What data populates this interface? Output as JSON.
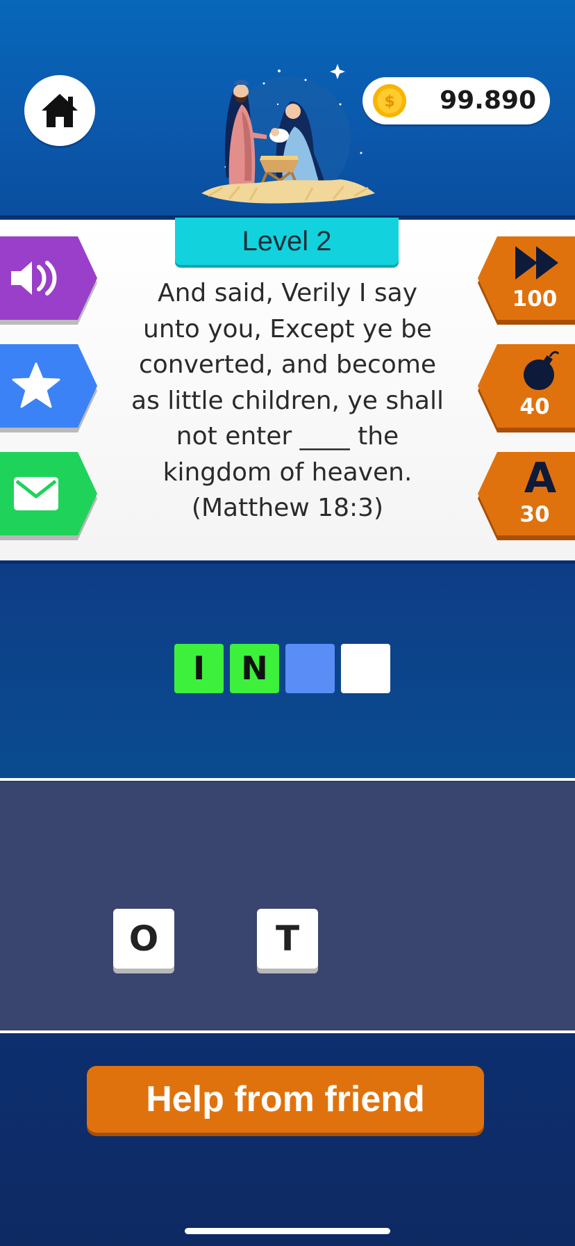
{
  "header": {
    "coins": "99.890"
  },
  "level": {
    "label": "Level 2"
  },
  "verse": {
    "lines": [
      "And said, Verily I say",
      "unto you, Except ye be",
      "converted, and become",
      "as little children, ye shall",
      "not enter ____ the",
      "kingdom of heaven.",
      "(Matthew 18:3)"
    ]
  },
  "left_actions": [
    {
      "name": "sound-icon",
      "color": "#9a3fc9"
    },
    {
      "name": "star-icon",
      "color": "#3b82f6"
    },
    {
      "name": "mail-icon",
      "color": "#1fd35a"
    }
  ],
  "powerups": [
    {
      "name": "skip-icon",
      "cost": "100"
    },
    {
      "name": "bomb-icon",
      "cost": "40"
    },
    {
      "name": "letter-hint-icon",
      "glyph": "A",
      "cost": "30"
    }
  ],
  "answer_slots": [
    {
      "letter": "I",
      "state": "correct",
      "color": "#3cf03c"
    },
    {
      "letter": "N",
      "state": "correct",
      "color": "#3cf03c"
    },
    {
      "letter": "",
      "state": "selected",
      "color": "#5b8df6"
    },
    {
      "letter": "",
      "state": "empty",
      "color": "#ffffff"
    }
  ],
  "letter_tiles": [
    "O",
    "T"
  ],
  "help_button": {
    "label": "Help from friend"
  }
}
